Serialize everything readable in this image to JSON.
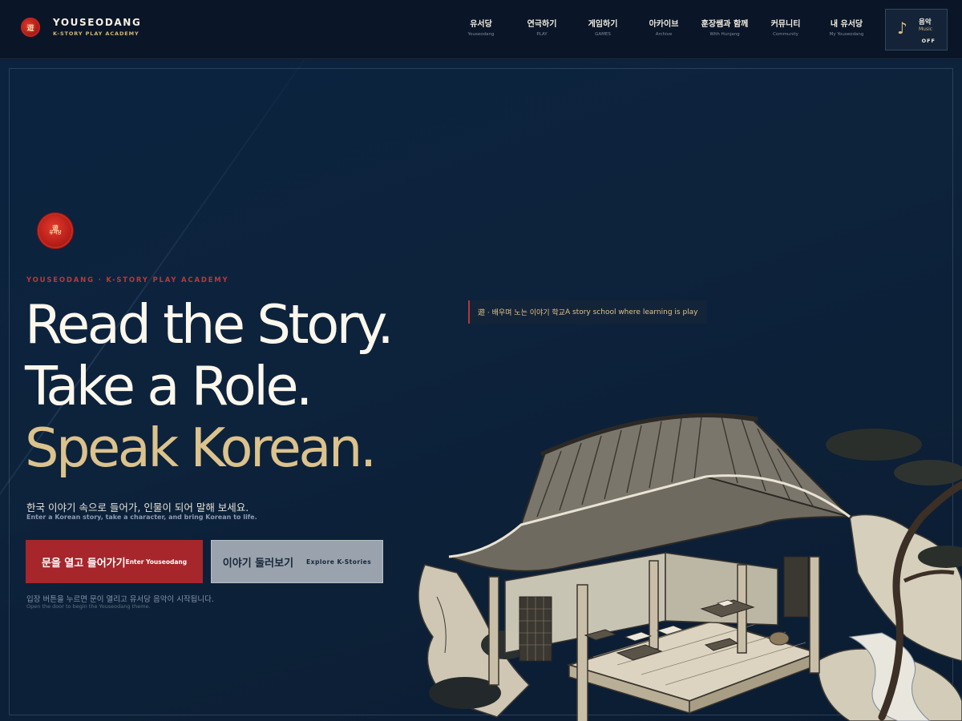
{
  "brand": {
    "title": "YOUSEODANG",
    "subtitle": "K-STORY PLAY ACADEMY",
    "seal_glyph": "遊"
  },
  "nav": {
    "items": [
      {
        "ko": "유서당",
        "en": "Youseodang"
      },
      {
        "ko": "연극하기",
        "en": "PLAY"
      },
      {
        "ko": "게임하기",
        "en": "GAMES"
      },
      {
        "ko": "아카이브",
        "en": "Archive"
      },
      {
        "ko": "훈장쌤과 함께",
        "en": "With Hunjang"
      },
      {
        "ko": "커뮤니티",
        "en": "Community"
      },
      {
        "ko": "내 유서당",
        "en": "My Youseodang"
      }
    ]
  },
  "music": {
    "label_ko": "음악",
    "label_en": "Music",
    "state": "OFF",
    "icon": "music-note-icon"
  },
  "hero": {
    "seal_line1": "遊",
    "seal_line2": "유서당",
    "eyebrow": "YOUSEODANG · K-STORY PLAY ACADEMY",
    "headline_1": "Read the Story.",
    "headline_2": "Take a Role.",
    "headline_3": "Speak Korean.",
    "sub_ko": "한국 이야기 속으로 들어가, 인물이 되어 말해 보세요.",
    "sub_en": "Enter a Korean story, take a character, and bring Korean to life.",
    "primary_ko": "문을 열고 들어가기",
    "primary_en": "Enter Youseodang",
    "secondary_ko": "이야기 둘러보기",
    "secondary_en": "Explore K-Stories",
    "note_ko": "입장 버튼을 누르면 문이 열리고 유서당 음악이 시작됩니다.",
    "note_en": "Open the door to begin the Youseodang theme.",
    "tagline_ko": "遊 · 배우며 노는 이야기 학교",
    "tagline_en": "A story school where learning is play"
  },
  "colors": {
    "accent_red": "#a6262b",
    "gold": "#dcc28c",
    "bg_navy": "#0b1a2d"
  }
}
